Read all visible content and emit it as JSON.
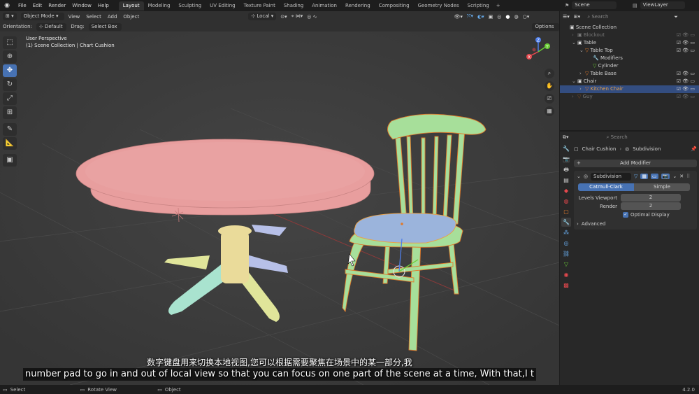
{
  "topbar": {
    "menu": [
      "File",
      "Edit",
      "Render",
      "Window",
      "Help"
    ],
    "tabs": [
      "Layout",
      "Modeling",
      "Sculpting",
      "UV Editing",
      "Texture Paint",
      "Shading",
      "Animation",
      "Rendering",
      "Compositing",
      "Geometry Nodes",
      "Scripting"
    ],
    "active_tab": "Layout",
    "scene_label": "Scene",
    "view_layer_label": "ViewLayer"
  },
  "viewport_header": {
    "mode": "Object Mode",
    "menus": [
      "View",
      "Select",
      "Add",
      "Object"
    ],
    "transform_space": "Local",
    "orientation_label": "Orientation:",
    "orientation_value": "Default",
    "drag_label": "Drag:",
    "drag_value": "Select Box",
    "options_label": "Options"
  },
  "viewport": {
    "perspective_text": "User Perspective",
    "collection_text": "(1) Scene Collection | Chart Cushion",
    "gizmo_axes": [
      "Z",
      "Y",
      "X"
    ]
  },
  "colors": {
    "table_top": "#e89e9e",
    "table_column": "#eadb9a",
    "table_leg_cyan": "#a9e3cf",
    "table_leg_yellow": "#e0e59a",
    "table_leg_lavender": "#b7c0e8",
    "chair": "#a7df9a",
    "cushion": "#9bb4dc",
    "accent": "#4772b3",
    "selected_orange": "#e07a2c"
  },
  "outliner": {
    "search_placeholder": "Search",
    "items": [
      {
        "label": "Scene Collection",
        "indent": 0,
        "type": "collection"
      },
      {
        "label": "Blockout",
        "indent": 1,
        "type": "collection",
        "dim": true
      },
      {
        "label": "Table",
        "indent": 1,
        "type": "collection"
      },
      {
        "label": "Table Top",
        "indent": 2,
        "type": "mesh"
      },
      {
        "label": "Modifiers",
        "indent": 3,
        "type": "modifier"
      },
      {
        "label": "Cylinder",
        "indent": 3,
        "type": "mesh-data"
      },
      {
        "label": "Table Base",
        "indent": 2,
        "type": "mesh"
      },
      {
        "label": "Chair",
        "indent": 1,
        "type": "collection"
      },
      {
        "label": "Kitchen Chair",
        "indent": 2,
        "type": "mesh",
        "selected": true
      },
      {
        "label": "Guy",
        "indent": 1,
        "type": "mesh",
        "dim": true
      }
    ]
  },
  "properties": {
    "search_placeholder": "Search",
    "breadcrumb_object": "Chair Cushion",
    "breadcrumb_modifier": "Subdivision",
    "add_modifier_label": "Add Modifier",
    "modifier_name": "Subdivision",
    "catmull_label": "Catmull-Clark",
    "simple_label": "Simple",
    "levels_viewport_label": "Levels Viewport",
    "levels_viewport_value": "2",
    "render_label": "Render",
    "render_value": "2",
    "optimal_display_label": "Optimal Display",
    "advanced_label": "Advanced"
  },
  "subtitles": {
    "chinese": "数字键盘用来切换本地视图,您可以根据需要聚焦在场景中的某一部分,我",
    "english": "number pad to go in and out of local view so that you can focus on one part of the scene at a time, With that,I t"
  },
  "statusbar": {
    "select": "Select",
    "rotate_view": "Rotate View",
    "object": "Object",
    "version": "4.2.0"
  }
}
